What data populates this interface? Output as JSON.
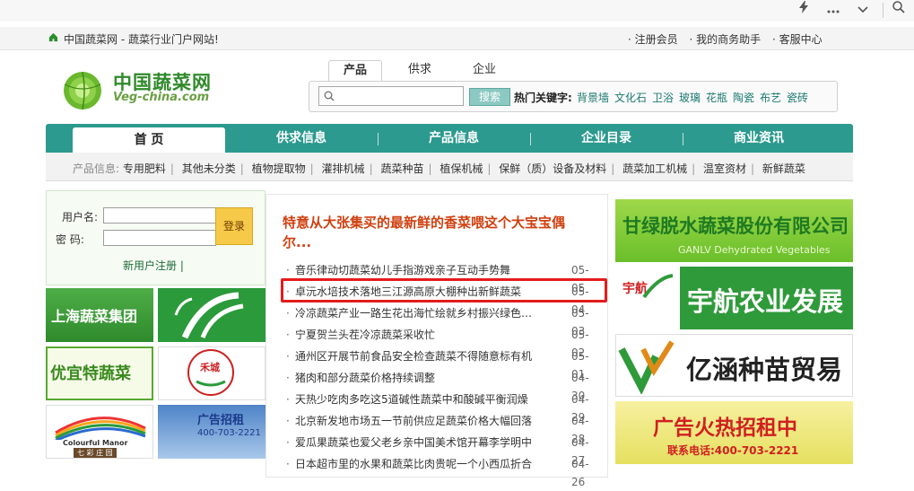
{
  "browser": {
    "icons": [
      "lightning-icon",
      "more-icon",
      "chevron-down-icon",
      "search-icon"
    ]
  },
  "topbar": {
    "title": "中国蔬菜网 - 蔬菜行业门户网站!",
    "links": [
      "· 注册会员",
      "· 我的商务助手",
      "· 客服中心"
    ]
  },
  "logo": {
    "cn": "中国蔬菜网",
    "en": "Veg-china.com"
  },
  "search": {
    "tabs": [
      "产品",
      "供求",
      "企业"
    ],
    "button": "搜索",
    "placeholder": "",
    "hot_label": "热门关键字:",
    "hot_keywords": [
      "背景墙",
      "文化石",
      "卫浴",
      "玻璃",
      "花瓶",
      "陶瓷",
      "布艺",
      "瓷砖"
    ]
  },
  "nav": {
    "items": [
      "首 页",
      "供求信息",
      "产品信息",
      "企业目录",
      "商业资讯"
    ]
  },
  "subnav": {
    "label": "产品信息:",
    "items": [
      "专用肥料",
      "其他未分类",
      "植物提取物",
      "灌排机械",
      "蔬菜种苗",
      "植保机械",
      "保鲜（质）设备及材料",
      "蔬菜加工机械",
      "温室资材",
      "新鲜蔬菜"
    ]
  },
  "login": {
    "username_label": "用户名:",
    "password_label": "密 码:",
    "button": "登录",
    "register": "新用户注册 |"
  },
  "ads_left": [
    {
      "text": "上海蔬菜集团",
      "color": "#3a9a38"
    },
    {
      "text": "",
      "color": "#2a9a3a"
    },
    {
      "text": "优宜特蔬菜",
      "color": "#5aa830"
    },
    {
      "text": "禾城",
      "color": "#cc2020"
    },
    {
      "text": "Colourful Manor",
      "sub": "七 彩 庄 园"
    },
    {
      "text": "广告招租",
      "sub": "400-703-2221"
    }
  ],
  "news": {
    "headline": "特意从大张集买的最新鲜的香菜喂这个大宝宝偶尔...",
    "items": [
      {
        "title": "音乐律动切蔬菜幼儿手指游戏亲子互动手势舞",
        "date": "05-05"
      },
      {
        "title": "卓沅水培技术落地三江源高原大棚种出新鲜蔬菜",
        "date": "05-04"
      },
      {
        "title": "冷凉蔬菜产业一路生花出海忙绘就乡村振兴绿色画卷",
        "date": "05-03"
      },
      {
        "title": "宁夏贺兰头茬冷凉蔬菜采收忙",
        "date": "05-02"
      },
      {
        "title": "通州区开展节前食品安全检查蔬菜不得随意标有机",
        "date": "05-01"
      },
      {
        "title": "猪肉和部分蔬菜价格持续调整",
        "date": "04-30"
      },
      {
        "title": "天热少吃肉多吃这5道碱性蔬菜中和酸碱平衡润燥",
        "date": "04-29"
      },
      {
        "title": "北京新发地市场五一节前供应足蔬菜价格大幅回落",
        "date": "04-28"
      },
      {
        "title": "爱瓜果蔬菜也爱父老乡亲中国美术馆开幕李学明中",
        "date": "04-27"
      },
      {
        "title": "日本超市里的水果和蔬菜比肉贵呢一个小西瓜折合",
        "date": "04-26"
      }
    ]
  },
  "ads_right": [
    {
      "title": "甘绿脱水蔬菜股份有限公司",
      "sub": "GANLV Dehydrated Vegetables",
      "color": "#2f9a3a"
    },
    {
      "title": "宇航农业发展",
      "logo": "宇航",
      "color": "#2f9a3a"
    },
    {
      "title": "亿涵种苗贸易",
      "color": "#222222"
    },
    {
      "title": "广告火热招租中",
      "sub": "联系电话:400-703-2221",
      "color": "#d02020"
    }
  ]
}
